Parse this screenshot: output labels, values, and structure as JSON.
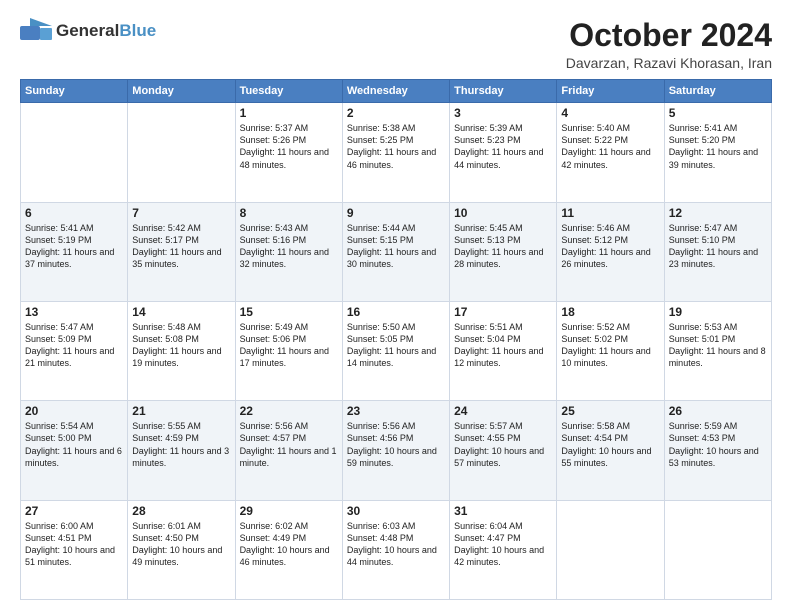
{
  "header": {
    "logo_general": "General",
    "logo_blue": "Blue",
    "month": "October 2024",
    "location": "Davarzan, Razavi Khorasan, Iran"
  },
  "weekdays": [
    "Sunday",
    "Monday",
    "Tuesday",
    "Wednesday",
    "Thursday",
    "Friday",
    "Saturday"
  ],
  "weeks": [
    [
      {
        "day": "",
        "sunrise": "",
        "sunset": "",
        "daylight": ""
      },
      {
        "day": "",
        "sunrise": "",
        "sunset": "",
        "daylight": ""
      },
      {
        "day": "1",
        "sunrise": "Sunrise: 5:37 AM",
        "sunset": "Sunset: 5:26 PM",
        "daylight": "Daylight: 11 hours and 48 minutes."
      },
      {
        "day": "2",
        "sunrise": "Sunrise: 5:38 AM",
        "sunset": "Sunset: 5:25 PM",
        "daylight": "Daylight: 11 hours and 46 minutes."
      },
      {
        "day": "3",
        "sunrise": "Sunrise: 5:39 AM",
        "sunset": "Sunset: 5:23 PM",
        "daylight": "Daylight: 11 hours and 44 minutes."
      },
      {
        "day": "4",
        "sunrise": "Sunrise: 5:40 AM",
        "sunset": "Sunset: 5:22 PM",
        "daylight": "Daylight: 11 hours and 42 minutes."
      },
      {
        "day": "5",
        "sunrise": "Sunrise: 5:41 AM",
        "sunset": "Sunset: 5:20 PM",
        "daylight": "Daylight: 11 hours and 39 minutes."
      }
    ],
    [
      {
        "day": "6",
        "sunrise": "Sunrise: 5:41 AM",
        "sunset": "Sunset: 5:19 PM",
        "daylight": "Daylight: 11 hours and 37 minutes."
      },
      {
        "day": "7",
        "sunrise": "Sunrise: 5:42 AM",
        "sunset": "Sunset: 5:17 PM",
        "daylight": "Daylight: 11 hours and 35 minutes."
      },
      {
        "day": "8",
        "sunrise": "Sunrise: 5:43 AM",
        "sunset": "Sunset: 5:16 PM",
        "daylight": "Daylight: 11 hours and 32 minutes."
      },
      {
        "day": "9",
        "sunrise": "Sunrise: 5:44 AM",
        "sunset": "Sunset: 5:15 PM",
        "daylight": "Daylight: 11 hours and 30 minutes."
      },
      {
        "day": "10",
        "sunrise": "Sunrise: 5:45 AM",
        "sunset": "Sunset: 5:13 PM",
        "daylight": "Daylight: 11 hours and 28 minutes."
      },
      {
        "day": "11",
        "sunrise": "Sunrise: 5:46 AM",
        "sunset": "Sunset: 5:12 PM",
        "daylight": "Daylight: 11 hours and 26 minutes."
      },
      {
        "day": "12",
        "sunrise": "Sunrise: 5:47 AM",
        "sunset": "Sunset: 5:10 PM",
        "daylight": "Daylight: 11 hours and 23 minutes."
      }
    ],
    [
      {
        "day": "13",
        "sunrise": "Sunrise: 5:47 AM",
        "sunset": "Sunset: 5:09 PM",
        "daylight": "Daylight: 11 hours and 21 minutes."
      },
      {
        "day": "14",
        "sunrise": "Sunrise: 5:48 AM",
        "sunset": "Sunset: 5:08 PM",
        "daylight": "Daylight: 11 hours and 19 minutes."
      },
      {
        "day": "15",
        "sunrise": "Sunrise: 5:49 AM",
        "sunset": "Sunset: 5:06 PM",
        "daylight": "Daylight: 11 hours and 17 minutes."
      },
      {
        "day": "16",
        "sunrise": "Sunrise: 5:50 AM",
        "sunset": "Sunset: 5:05 PM",
        "daylight": "Daylight: 11 hours and 14 minutes."
      },
      {
        "day": "17",
        "sunrise": "Sunrise: 5:51 AM",
        "sunset": "Sunset: 5:04 PM",
        "daylight": "Daylight: 11 hours and 12 minutes."
      },
      {
        "day": "18",
        "sunrise": "Sunrise: 5:52 AM",
        "sunset": "Sunset: 5:02 PM",
        "daylight": "Daylight: 11 hours and 10 minutes."
      },
      {
        "day": "19",
        "sunrise": "Sunrise: 5:53 AM",
        "sunset": "Sunset: 5:01 PM",
        "daylight": "Daylight: 11 hours and 8 minutes."
      }
    ],
    [
      {
        "day": "20",
        "sunrise": "Sunrise: 5:54 AM",
        "sunset": "Sunset: 5:00 PM",
        "daylight": "Daylight: 11 hours and 6 minutes."
      },
      {
        "day": "21",
        "sunrise": "Sunrise: 5:55 AM",
        "sunset": "Sunset: 4:59 PM",
        "daylight": "Daylight: 11 hours and 3 minutes."
      },
      {
        "day": "22",
        "sunrise": "Sunrise: 5:56 AM",
        "sunset": "Sunset: 4:57 PM",
        "daylight": "Daylight: 11 hours and 1 minute."
      },
      {
        "day": "23",
        "sunrise": "Sunrise: 5:56 AM",
        "sunset": "Sunset: 4:56 PM",
        "daylight": "Daylight: 10 hours and 59 minutes."
      },
      {
        "day": "24",
        "sunrise": "Sunrise: 5:57 AM",
        "sunset": "Sunset: 4:55 PM",
        "daylight": "Daylight: 10 hours and 57 minutes."
      },
      {
        "day": "25",
        "sunrise": "Sunrise: 5:58 AM",
        "sunset": "Sunset: 4:54 PM",
        "daylight": "Daylight: 10 hours and 55 minutes."
      },
      {
        "day": "26",
        "sunrise": "Sunrise: 5:59 AM",
        "sunset": "Sunset: 4:53 PM",
        "daylight": "Daylight: 10 hours and 53 minutes."
      }
    ],
    [
      {
        "day": "27",
        "sunrise": "Sunrise: 6:00 AM",
        "sunset": "Sunset: 4:51 PM",
        "daylight": "Daylight: 10 hours and 51 minutes."
      },
      {
        "day": "28",
        "sunrise": "Sunrise: 6:01 AM",
        "sunset": "Sunset: 4:50 PM",
        "daylight": "Daylight: 10 hours and 49 minutes."
      },
      {
        "day": "29",
        "sunrise": "Sunrise: 6:02 AM",
        "sunset": "Sunset: 4:49 PM",
        "daylight": "Daylight: 10 hours and 46 minutes."
      },
      {
        "day": "30",
        "sunrise": "Sunrise: 6:03 AM",
        "sunset": "Sunset: 4:48 PM",
        "daylight": "Daylight: 10 hours and 44 minutes."
      },
      {
        "day": "31",
        "sunrise": "Sunrise: 6:04 AM",
        "sunset": "Sunset: 4:47 PM",
        "daylight": "Daylight: 10 hours and 42 minutes."
      },
      {
        "day": "",
        "sunrise": "",
        "sunset": "",
        "daylight": ""
      },
      {
        "day": "",
        "sunrise": "",
        "sunset": "",
        "daylight": ""
      }
    ]
  ]
}
